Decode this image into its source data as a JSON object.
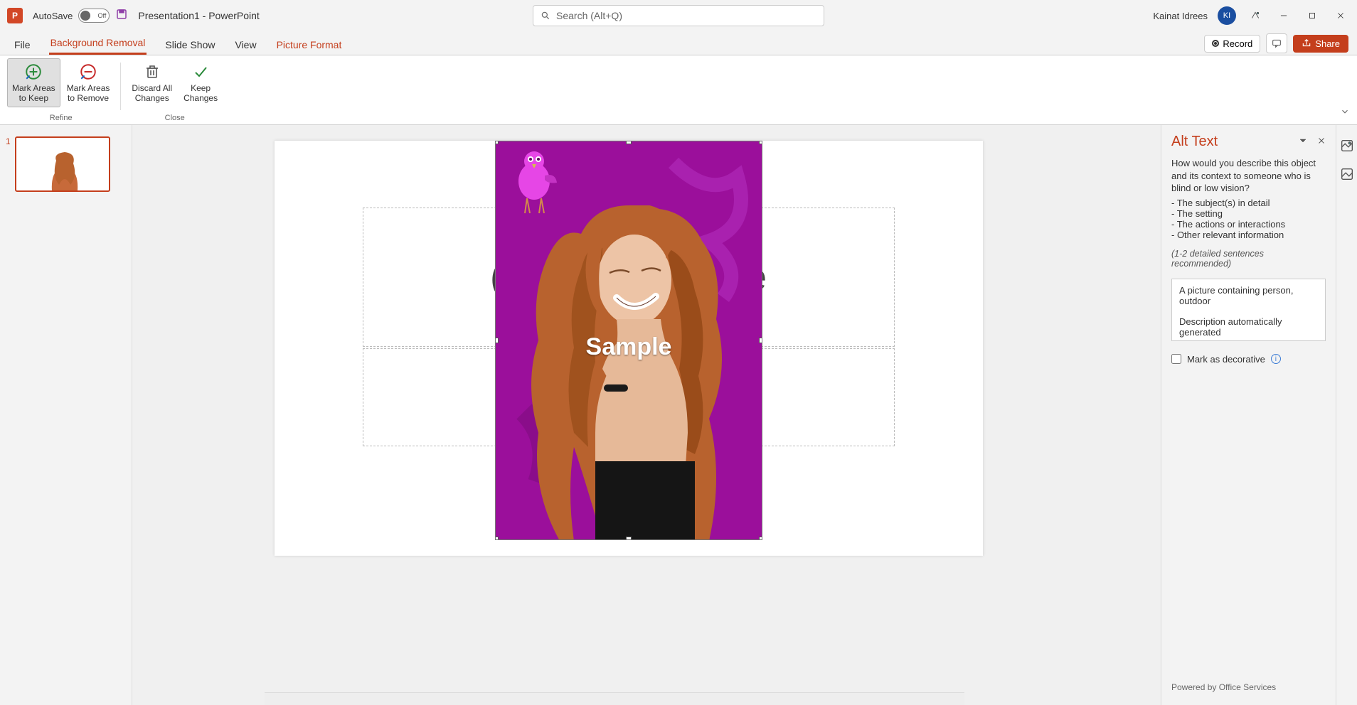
{
  "titlebar": {
    "autosave_label": "AutoSave",
    "autosave_state": "Off",
    "doc_title": "Presentation1  -  PowerPoint",
    "search_placeholder": "Search (Alt+Q)",
    "username": "Kainat Idrees",
    "avatar_initials": "KI"
  },
  "tabs": {
    "file": "File",
    "bg_removal": "Background Removal",
    "slide_show": "Slide Show",
    "view": "View",
    "picture_format": "Picture Format",
    "record": "Record",
    "share": "Share"
  },
  "ribbon": {
    "mark_keep_l1": "Mark Areas",
    "mark_keep_l2": "to Keep",
    "mark_remove_l1": "Mark Areas",
    "mark_remove_l2": "to Remove",
    "discard_l1": "Discard All",
    "discard_l2": "Changes",
    "keep_l1": "Keep",
    "keep_l2": "Changes",
    "group_refine": "Refine",
    "group_close": "Close"
  },
  "thumbnails": {
    "slide1_num": "1"
  },
  "slide": {
    "sample_text": "Sample",
    "title_partial_left": "(",
    "title_partial_right": "e"
  },
  "alttext": {
    "pane_title": "Alt Text",
    "q": "How would you describe this object and its context to someone who is blind or low vision?",
    "b1": "- The subject(s) in detail",
    "b2": "- The setting",
    "b3": "- The actions or interactions",
    "b4": "- Other relevant information",
    "hint": "(1-2 detailed sentences recommended)",
    "box_l1": "A picture containing person, outdoor",
    "box_l2": "Description automatically generated",
    "decorative": "Mark as decorative",
    "powered": "Powered by Office Services"
  }
}
